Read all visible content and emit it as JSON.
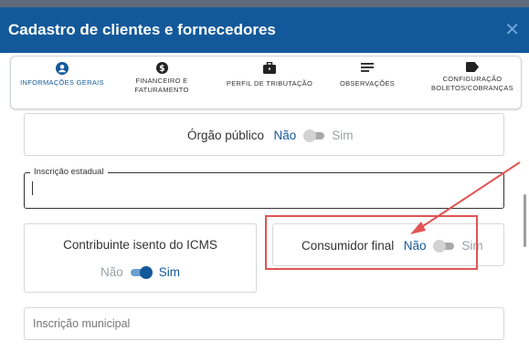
{
  "header": {
    "title": "Cadastro de clientes e fornecedores",
    "close_label": "✕"
  },
  "tabs": [
    {
      "label": "INFORMAÇÕES GERAIS",
      "icon": "user-circle-icon"
    },
    {
      "label": "FINANCEIRO E FATURAMENTO",
      "icon": "dollar-circle-icon"
    },
    {
      "label": "PERFIL DE TRIBUTAÇÃO",
      "icon": "briefcase-icon"
    },
    {
      "label": "OBSERVAÇÕES",
      "icon": "lines-icon"
    },
    {
      "label": "CONFIGURAÇÃO BOLETOS/COBRANÇAS",
      "icon": "tag-icon"
    }
  ],
  "orgao_publico": {
    "label": "Órgão público",
    "no": "Não",
    "yes": "Sim",
    "value": false
  },
  "inscricao_estadual": {
    "label": "Inscrição estadual",
    "value": ""
  },
  "isento_icms": {
    "label": "Contribuinte isento do ICMS",
    "no": "Não",
    "yes": "Sim",
    "value": true
  },
  "consumidor_final": {
    "label": "Consumidor final",
    "no": "Não",
    "yes": "Sim",
    "value": false
  },
  "inscricao_municipal": {
    "placeholder": "Inscrição municipal",
    "value": ""
  },
  "colors": {
    "primary": "#13599a",
    "highlight": "#e05454"
  }
}
